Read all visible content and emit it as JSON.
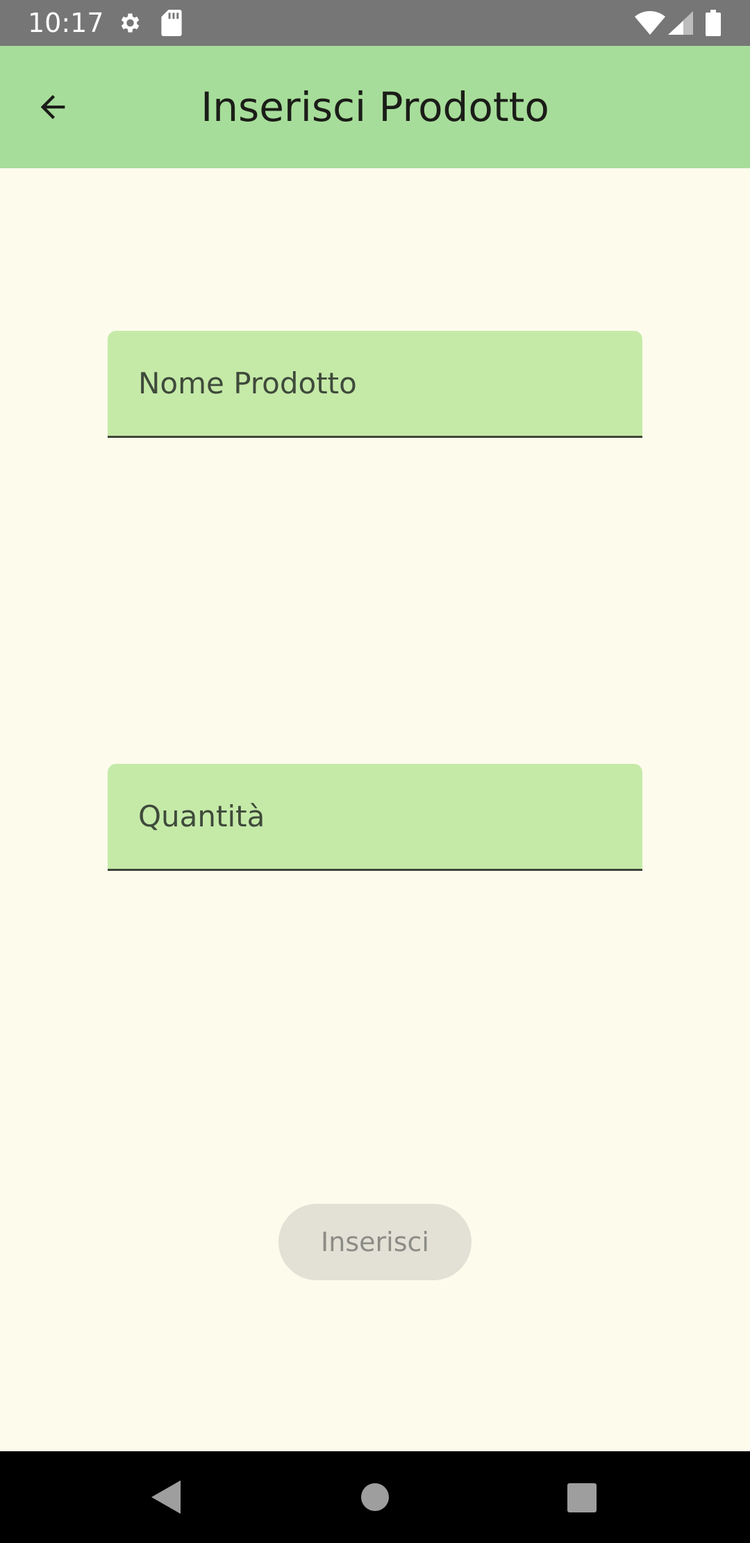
{
  "status_bar": {
    "time": "10:17",
    "icons": [
      "settings-gear-icon",
      "sd-card-icon",
      "wifi-icon",
      "cell-signal-icon",
      "battery-icon"
    ]
  },
  "app_bar": {
    "title": "Inserisci Prodotto",
    "back_icon": "arrow-back-icon"
  },
  "form": {
    "name_field": {
      "placeholder": "Nome Prodotto",
      "value": ""
    },
    "quantity_field": {
      "placeholder": "Quantità",
      "value": ""
    },
    "submit_label": "Inserisci",
    "submit_enabled": false
  },
  "nav_bar": {
    "icons": [
      "nav-back-icon",
      "nav-home-icon",
      "nav-recents-icon"
    ]
  },
  "colors": {
    "app_bar": "#a7dd9a",
    "background": "#fdfbec",
    "field_fill": "#c5eaa8",
    "status_bar": "#767676",
    "button_disabled": "#e3e1d5"
  }
}
